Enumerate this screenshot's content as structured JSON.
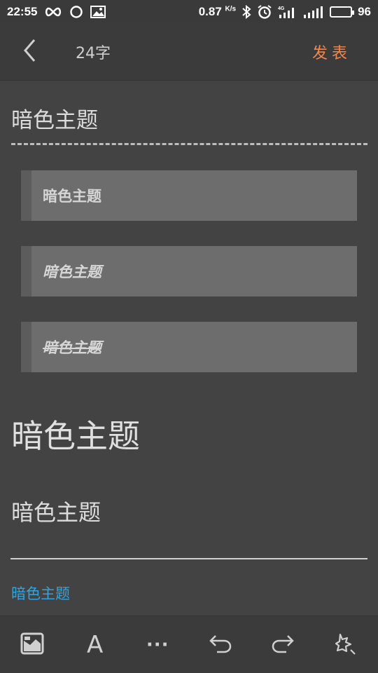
{
  "status_bar": {
    "time": "22:55",
    "net_speed": "0.87",
    "speed_unit": "K/s",
    "battery": "96",
    "battery_level": 0.96,
    "icons": [
      "infinity-icon",
      "circle-icon",
      "image-icon",
      "bluetooth-icon",
      "alarm-icon",
      "4g-signal-icon",
      "wifi-signal-icon",
      "battery-icon"
    ]
  },
  "top_bar": {
    "back_icon": "chevron-left-icon",
    "word_count": "24字",
    "publish": "发表"
  },
  "editor": {
    "title": "暗色主题",
    "quotes": [
      {
        "text": "暗色主题",
        "style": "bold"
      },
      {
        "text": "暗色主题",
        "style": "bold-italic"
      },
      {
        "text": "暗色主题",
        "style": "bold-italic-strikethrough"
      }
    ],
    "heading_large": "暗色主题",
    "heading_medium": "暗色主题",
    "link": "暗色主题"
  },
  "bottom_bar": {
    "tools": [
      "image-icon",
      "font-icon",
      "more-icon",
      "undo-icon",
      "redo-icon",
      "clear-format-icon"
    ],
    "font_label": "A",
    "more_label": "···"
  },
  "colors": {
    "background": "#434343",
    "accent": "#f0874b",
    "link": "#33a3dc"
  }
}
